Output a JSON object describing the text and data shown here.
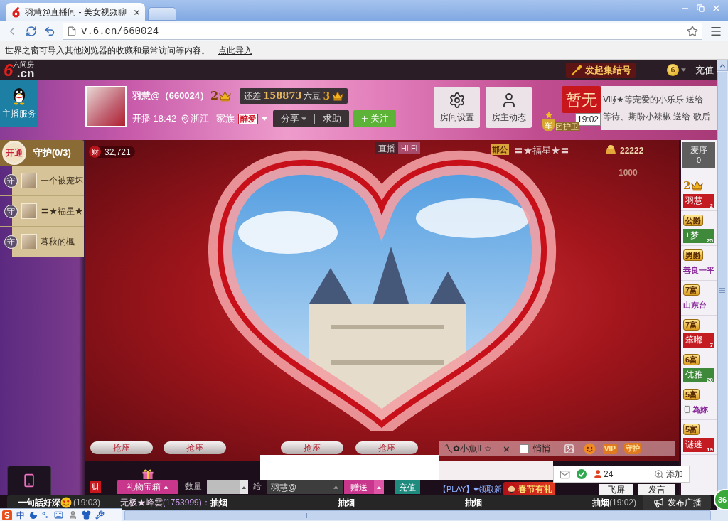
{
  "browser": {
    "tab_title": "羽慧@直播间 - 美女视频聊",
    "url": "v.6.cn/660024",
    "info_text": "世界之窗可导入其他浏览器的收藏和最常访问等内容。",
    "info_link": "点此导入"
  },
  "topbar": {
    "logo_mark": "6",
    "logo_text": ".cn",
    "logo_sub": "六间房",
    "rally": "发起集结号",
    "coin": "6",
    "recharge": "充值"
  },
  "service": {
    "label": "主播服务"
  },
  "host": {
    "name": "羽慧@（660024）",
    "level": "2",
    "gap_label": "还差",
    "gap_value": "158873",
    "gap_unit": "六豆",
    "next_level": "3",
    "start": "开播 18:42",
    "location": "浙江",
    "family_label": "家族",
    "family_badge": "醉爱"
  },
  "actions": [
    {
      "kind": "dropdown",
      "label": "分享"
    },
    {
      "kind": "plain",
      "label": "求助"
    },
    {
      "kind": "follow",
      "label": "关注"
    }
  ],
  "room_buttons": [
    {
      "kind": "settings",
      "label": "房间设置"
    },
    {
      "kind": "profile",
      "label": "房主动态"
    }
  ],
  "rank": {
    "badge": "暂无",
    "guard_mark": "军",
    "guard_label": "团护卫"
  },
  "ticker": [
    {
      "text": "Ⅶ∮★等宠爱的小乐乐 送给"
    },
    {
      "time": "19:02",
      "text": "等待、期盼小辣椒 送给 歌后"
    }
  ],
  "guard": {
    "open": "开通",
    "title": "守护(0/3)",
    "members": [
      {
        "mark": "守",
        "name": "一个被宠坏"
      },
      {
        "mark": "守",
        "name": "〓★福星★"
      },
      {
        "mark": "守",
        "name": "暮秋的楓"
      }
    ]
  },
  "stage": {
    "wealth_mark": "财",
    "wealth": "32,721",
    "mode": "直播",
    "quality": "Hi-Fi",
    "seats": [
      "抢座",
      "抢座",
      "抢座",
      "抢座"
    ]
  },
  "stage2": {
    "title_badge": "郡公",
    "user": "〓★福星★〓",
    "coins": "22222",
    "coins_small": "1000"
  },
  "chat_bar": {
    "target": "乀✿小魚IL☆",
    "clear": "×",
    "whisper": {
      "label": "悄悄",
      "checked": false
    },
    "tools": [
      {
        "kind": "image"
      },
      {
        "kind": "emoji"
      },
      {
        "kind": "vip",
        "label": "VIP"
      },
      {
        "kind": "guard",
        "label": "守护"
      }
    ]
  },
  "mic": {
    "title": "麦序",
    "count": "0",
    "users": [
      {
        "badge": {
          "kind": "crown",
          "text": "2"
        },
        "name": {
          "kind": "tag",
          "text": "羽慧",
          "num": "2",
          "color": "#c41a22"
        }
      },
      {
        "badge": {
          "kind": "title",
          "text": "公爵"
        },
        "name": {
          "kind": "tag",
          "text": "+梦",
          "num": "25",
          "color": "#3f8a3a"
        }
      },
      {
        "badge": {
          "kind": "title",
          "text": "男爵"
        },
        "name": {
          "kind": "text",
          "text": "善良一平",
          "color": "#8a2a9a"
        }
      },
      {
        "badge": {
          "kind": "rich",
          "text": "7富"
        },
        "name": {
          "kind": "text",
          "text": "山东台",
          "color": "#8a2a9a"
        }
      },
      {
        "badge": {
          "kind": "rich",
          "text": "7富"
        },
        "name": {
          "kind": "tag",
          "text": "笨嘟",
          "num": "7",
          "color": "#c41a22"
        }
      },
      {
        "badge": {
          "kind": "rich",
          "text": "6富"
        },
        "name": {
          "kind": "tag",
          "text": "优雅",
          "num": "20",
          "color": "#3f8a3a"
        }
      },
      {
        "badge": {
          "kind": "rich",
          "text": "5富"
        },
        "name": {
          "kind": "mobile",
          "text": "為妳",
          "color": "#8a2a9a"
        }
      },
      {
        "badge": {
          "kind": "rich",
          "text": "5富"
        },
        "name": {
          "kind": "tag",
          "text": "谜迷",
          "num": "19",
          "color": "#c41a22"
        }
      }
    ]
  },
  "gift": {
    "wealth_mark": "财",
    "box": "礼物宝箱",
    "quantity_label": "数量",
    "to_label": "给",
    "recipient": "羽慧@",
    "send": "赠送",
    "recharge": "充值"
  },
  "chat_tools": {
    "online": "24",
    "add": "添加"
  },
  "chat_input": {
    "promo": "【PLAY】♥领取新",
    "banner": "春节有礼",
    "fly": "飞屏",
    "speak": "发言"
  },
  "broadcast": {
    "items": [
      {
        "kind": "emoji",
        "user": "一句話好深",
        "time": "(19:03)"
      },
      {
        "kind": "message",
        "user": "无极★峰雲",
        "uid": "(1753999)：",
        "words": [
          "抽烟",
          "抽烟",
          "抽烟",
          "抽烟"
        ],
        "time": "(19:02)"
      }
    ],
    "publish": "发布广播"
  },
  "ime": {
    "mode": "中"
  },
  "float_badge": "36"
}
